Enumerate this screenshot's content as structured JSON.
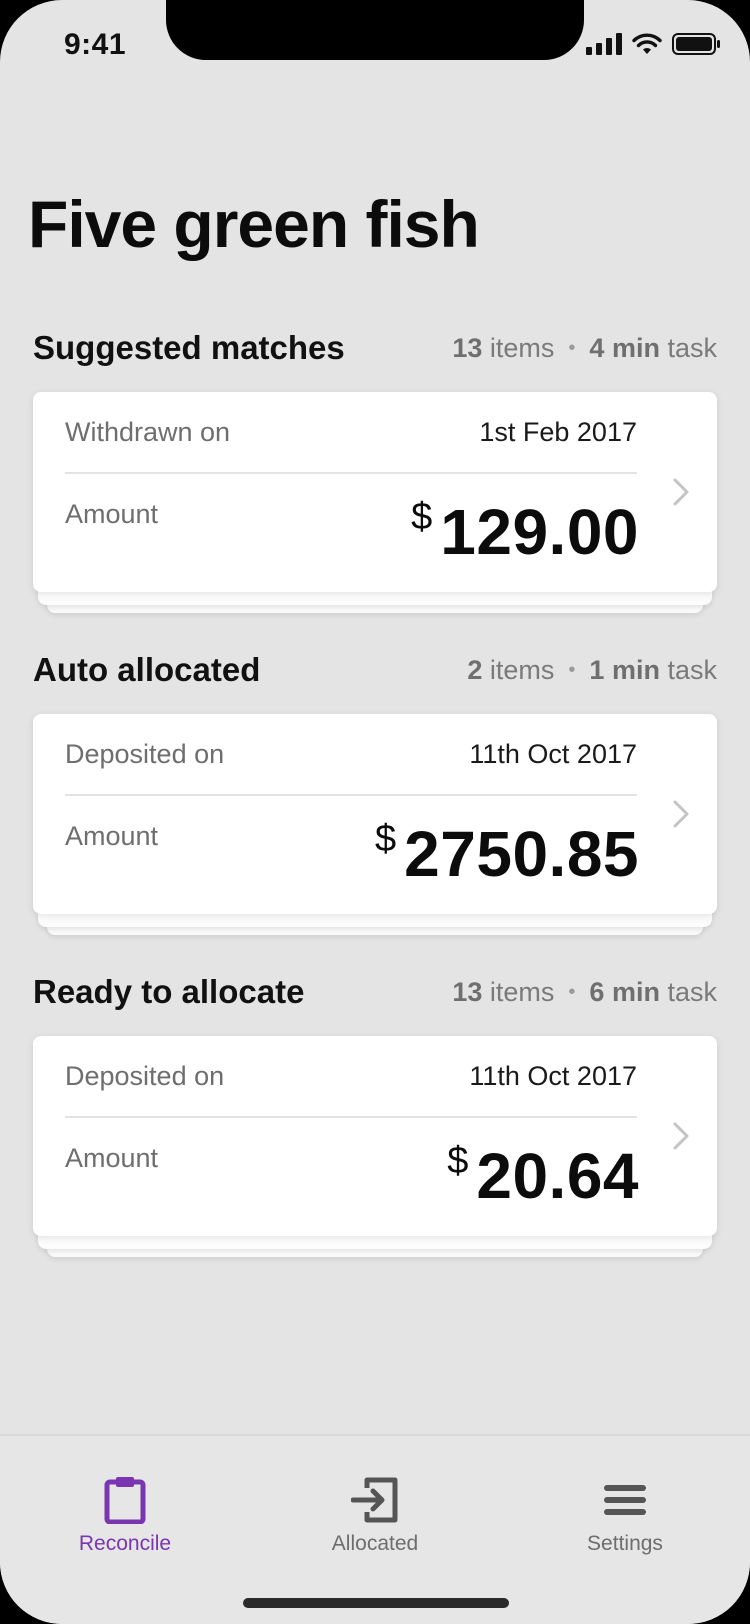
{
  "status_bar": {
    "time": "9:41"
  },
  "page": {
    "title": "Five green fish"
  },
  "sections": [
    {
      "title": "Suggested matches",
      "items_count": "13",
      "items_word": "items",
      "duration": "4 min",
      "task_word": "task",
      "date_label": "Withdrawn on",
      "date": "1st Feb 2017",
      "amount_label": "Amount",
      "currency": "$",
      "amount": "129.00"
    },
    {
      "title": "Auto allocated",
      "items_count": "2",
      "items_word": "items",
      "duration": "1 min",
      "task_word": "task",
      "date_label": "Deposited on",
      "date": "11th Oct 2017",
      "amount_label": "Amount",
      "currency": "$",
      "amount": "2750.85"
    },
    {
      "title": "Ready to allocate",
      "items_count": "13",
      "items_word": "items",
      "duration": "6 min",
      "task_word": "task",
      "date_label": "Deposited on",
      "date": "11th Oct 2017",
      "amount_label": "Amount",
      "currency": "$",
      "amount": "20.64"
    }
  ],
  "tabbar": {
    "items": [
      {
        "label": "Reconcile",
        "icon": "clipboard-icon",
        "active": true
      },
      {
        "label": "Allocated",
        "icon": "sign-in-icon",
        "active": false
      },
      {
        "label": "Settings",
        "icon": "menu-icon",
        "active": false
      }
    ]
  },
  "colors": {
    "accent": "#7a35b0",
    "background": "#e4e4e4",
    "card": "#ffffff"
  }
}
